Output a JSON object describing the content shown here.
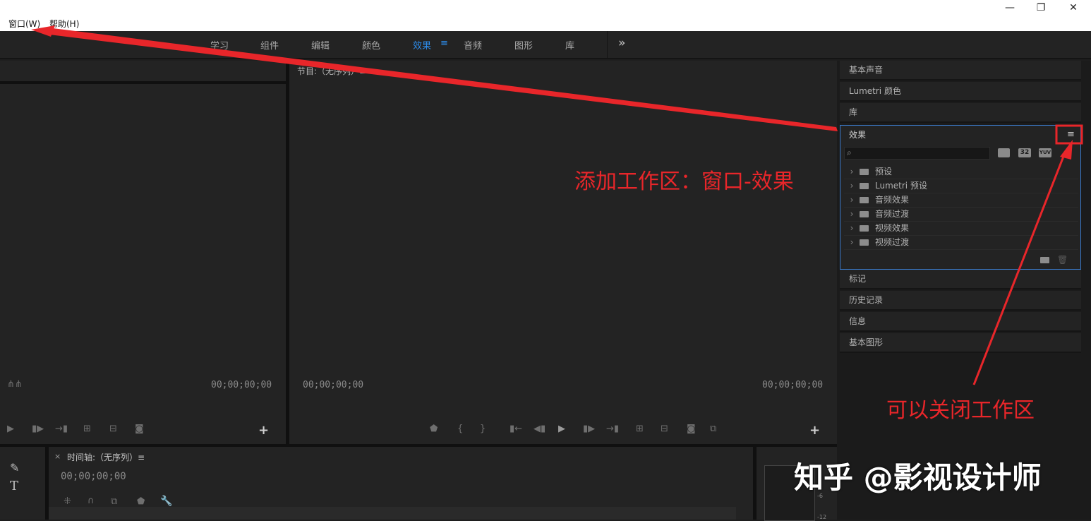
{
  "menu": {
    "window": "窗口(W)",
    "help": "帮助(H)"
  },
  "window_controls": {
    "minimize": "—",
    "restore": "❐",
    "close": "✕"
  },
  "workspaces": [
    "学习",
    "组件",
    "编辑",
    "颜色",
    "效果",
    "音频",
    "图形",
    "库"
  ],
  "workspace_menu_icon": "≡",
  "workspace_overflow": "»",
  "source": {
    "timecode": "00;00;00;00"
  },
  "program": {
    "title": "节目:（无序列）≡",
    "timecode_left": "00;00;00;00",
    "timecode_right": "00;00;00;00"
  },
  "right_panels": {
    "essential_sound": "基本声音",
    "lumetri_color": "Lumetri 颜色",
    "library": "库",
    "effects_title": "效果",
    "effects_menu": "≡",
    "badge_32": "32",
    "badge_yuv": "YUV",
    "effects_items": [
      "预设",
      "Lumetri 预设",
      "音频效果",
      "音频过渡",
      "视频效果",
      "视频过渡"
    ],
    "markers": "标记",
    "history": "历史记录",
    "info": "信息",
    "essential_graphics": "基本图形"
  },
  "timeline": {
    "close": "×",
    "title": "时间轴:（无序列）≡",
    "timecode": "00;00;00;00"
  },
  "meter_ticks": [
    "-6",
    "-12"
  ],
  "annotations": {
    "add_workspace": "添加工作区：窗口-效果",
    "close_workspace": "可以关闭工作区",
    "watermark": "知乎 @影视设计师"
  },
  "colors": {
    "accent_blue": "#2d8ceb",
    "annotation_red": "#e8262a"
  }
}
